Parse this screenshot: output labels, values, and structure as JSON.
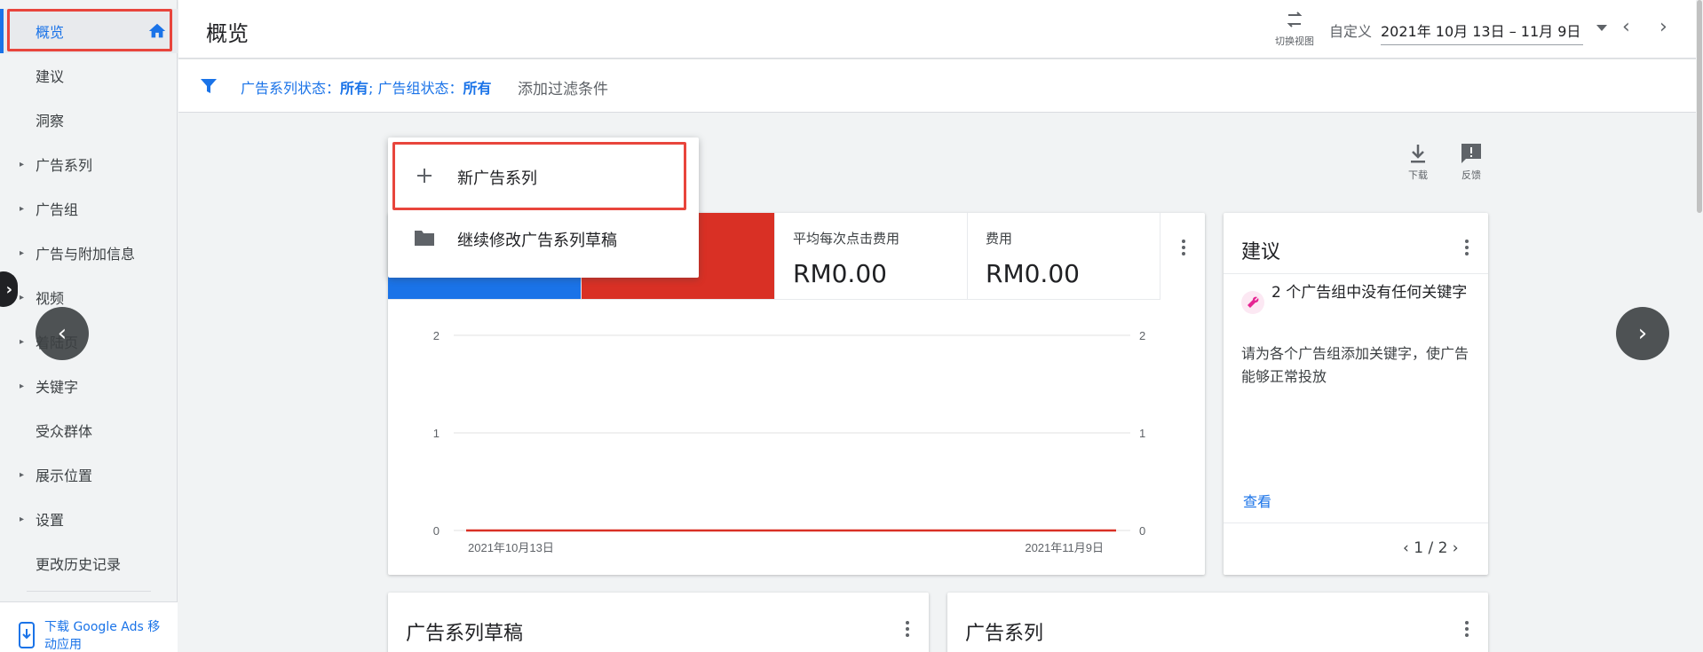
{
  "sidebar": {
    "items": [
      {
        "label": "概览",
        "expandable": false,
        "active": true
      },
      {
        "label": "建议",
        "expandable": false
      },
      {
        "label": "洞察",
        "expandable": false
      },
      {
        "label": "广告系列",
        "expandable": true
      },
      {
        "label": "广告组",
        "expandable": true
      },
      {
        "label": "广告与附加信息",
        "expandable": true
      },
      {
        "label": "视频",
        "expandable": true
      },
      {
        "label": "着陆页",
        "expandable": true
      },
      {
        "label": "关键字",
        "expandable": true
      },
      {
        "label": "受众群体",
        "expandable": false
      },
      {
        "label": "展示位置",
        "expandable": true
      },
      {
        "label": "设置",
        "expandable": true
      },
      {
        "label": "更改历史记录",
        "expandable": false
      }
    ],
    "download_app": "下载 Google Ads 移动应用"
  },
  "header": {
    "title": "概览",
    "switch_view": "切换视图",
    "date_type": "自定义",
    "date_range": "2021年 10月 13日 – 11月 9日"
  },
  "filter": {
    "text_prefix": "广告系列状态：",
    "campaign_status": "所有",
    "text_mid": "; 广告组状态：",
    "adgroup_status": "所有",
    "add": "添加过滤条件"
  },
  "toolbar": {
    "download": "下载",
    "feedback": "反馈"
  },
  "dropdown": {
    "new_campaign": "新广告系列",
    "continue_draft": "继续修改广告系列草稿"
  },
  "metrics": [
    {
      "label": "平均每次点击费用",
      "value": "RM0.00"
    },
    {
      "label": "费用",
      "value": "RM0.00"
    }
  ],
  "chart_data": {
    "type": "line",
    "x": [
      "2021年10月13日",
      "2021年11月9日"
    ],
    "series": [
      {
        "values": [
          0,
          0
        ],
        "color": "#d93025"
      }
    ],
    "ylim": [
      0,
      2
    ],
    "yticks": [
      "0",
      "1",
      "2"
    ],
    "grid": true
  },
  "suggestions": {
    "title": "建议",
    "headline": "2 个广告组中没有任何关键字",
    "body": "请为各个广告组添加关键字，使广告能够正常投放",
    "view": "查看",
    "pager": "1 / 2"
  },
  "bottom_cards": {
    "drafts_title": "广告系列草稿",
    "campaigns_title": "广告系列"
  },
  "colors": {
    "accent": "#1a73e8",
    "highlight": "#e8453c",
    "metric_red": "#d93025"
  }
}
